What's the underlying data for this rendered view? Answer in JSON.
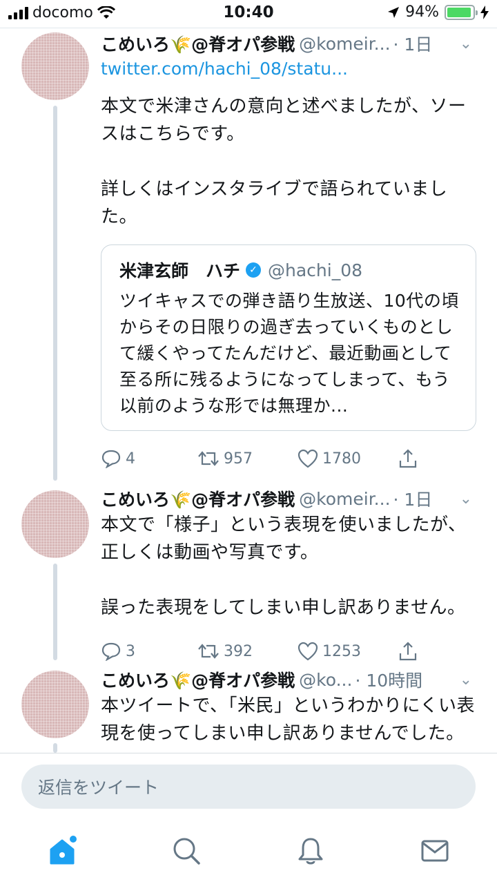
{
  "status_bar": {
    "carrier": "docomo",
    "time": "10:40",
    "battery": "94%",
    "battery_level": 0.94,
    "battery_color": "#4cd964"
  },
  "tweets": [
    {
      "name": "こめいろ🌾@脊オパ参戦",
      "handle": "@komeir...",
      "time": "· 1日",
      "link": "twitter.com/hachi_08/statu...",
      "text": "本文で米津さんの意向と述べましたが、ソースはこちらです。\n\n詳しくはインスタライブで語られていました。",
      "quote": {
        "name": "米津玄師　ハチ",
        "handle": "@hachi_08",
        "text": "ツイキャスでの弾き語り生放送、10代の頃からその日限りの過ぎ去っていくものとして緩くやってたんだけど、最近動画として至る所に残るようになってしまって、もう以前のような形では無理か..."
      },
      "replies": "4",
      "retweets": "957",
      "likes": "1780"
    },
    {
      "name": "こめいろ🌾@脊オパ参戦",
      "handle": "@komeir...",
      "time": "· 1日",
      "text": "本文で「様子」という表現を使いましたが、正しくは動画や写真です。\n\n誤った表現をしてしまい申し訳ありません。",
      "replies": "3",
      "retweets": "392",
      "likes": "1253"
    },
    {
      "name": "こめいろ🌾@脊オパ参戦",
      "handle": "@ko...",
      "time": "· 10時間",
      "text": "本ツイートで、「米民」というわかりにくい表現を使ってしまい申し訳ありませんでした。"
    }
  ],
  "reply_bar": {
    "placeholder": "返信をツイート"
  },
  "tab_bar": {
    "items": [
      "home-icon",
      "search-icon",
      "notifications-icon",
      "messages-icon"
    ],
    "accent": "#1da1f2",
    "icon_color": "#657786"
  },
  "colors": {
    "link": "#1b95e0",
    "secondary_text": "#657786",
    "thread_line": "#d3dbe3"
  }
}
